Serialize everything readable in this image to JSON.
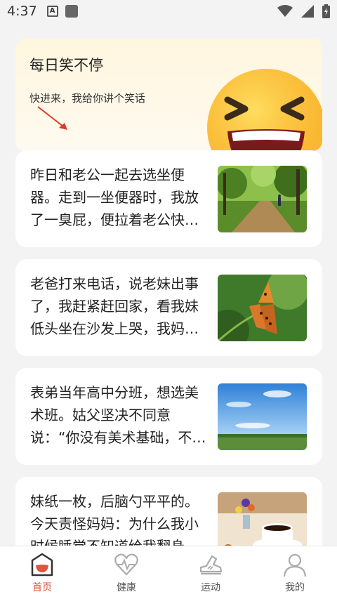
{
  "status": {
    "time": "4:37",
    "a_label": "A"
  },
  "banner": {
    "title": "每日笑不停",
    "subtitle": "快进来，我给你讲个笑话"
  },
  "jokes": [
    {
      "text": "昨日和老公一起去选坐便器。走到一坐便器时，我放了一臭屁，便拉着老公快…",
      "image": "forest-path"
    },
    {
      "text": "老爸打来电话，说老妹出事了，我赶紧赶回家，看我妹低头坐在沙发上哭，我妈…",
      "image": "butterfly"
    },
    {
      "text": "表弟当年高中分班，想选美术班。姑父坚决不同意说：“你没有美术基础，不能…",
      "image": "field-sky"
    },
    {
      "text": "妹纸一枚，后脑勺平平的。今天责怪妈妈：为什么我小时候睡觉不知道给我翻身…",
      "image": "coffee-flowers"
    }
  ],
  "tabs": [
    {
      "label": "首页",
      "icon": "home-icon",
      "active": true
    },
    {
      "label": "健康",
      "icon": "heart-icon",
      "active": false
    },
    {
      "label": "运动",
      "icon": "sneaker-icon",
      "active": false
    },
    {
      "label": "我的",
      "icon": "person-icon",
      "active": false
    }
  ],
  "colors": {
    "accent": "#e0533e",
    "banner_bg": "#fff6de",
    "emoji": "#ffc93a"
  }
}
